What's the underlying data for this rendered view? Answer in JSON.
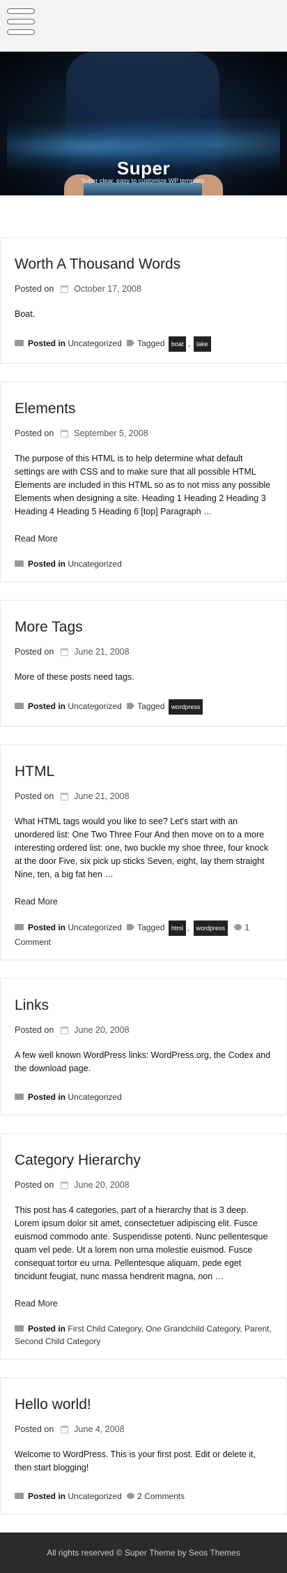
{
  "header": {
    "site_title": "Super",
    "tagline": "Super clear, easy to customize WP template."
  },
  "posts": [
    {
      "title": "Worth A Thousand Words",
      "posted_on": "Posted on",
      "date": "October 17, 2008",
      "excerpt": "Boat.",
      "posted_in_label": "Posted in",
      "categories": "Uncategorized",
      "tagged_label": "Tagged",
      "tags": [
        "boat",
        "lake"
      ]
    },
    {
      "title": "Elements",
      "posted_on": "Posted on",
      "date": "September 5, 2008",
      "excerpt": "The purpose of this HTML is to help determine what default settings are with CSS and to make sure that all possible HTML Elements are included in this HTML so as to not miss any possible Elements when designing a site. Heading 1 Heading 2 Heading 3 Heading 4 Heading 5 Heading 6 [top] Paragraph …",
      "read_more": "Read More",
      "posted_in_label": "Posted in",
      "categories": "Uncategorized"
    },
    {
      "title": "More Tags",
      "posted_on": "Posted on",
      "date": "June 21, 2008",
      "excerpt": "More of these posts need tags.",
      "posted_in_label": "Posted in",
      "categories": "Uncategorized",
      "tagged_label": "Tagged",
      "tags": [
        "wordpress"
      ]
    },
    {
      "title": "HTML",
      "posted_on": "Posted on",
      "date": "June 21, 2008",
      "excerpt": "What HTML tags would you like to see? Let's start with an unordered list: One Two Three Four And then move on to a more interesting ordered list: one, two buckle my shoe three, four knock at the door Five, six pick up sticks Seven, eight, lay them straight Nine, ten, a big fat hen …",
      "read_more": "Read More",
      "posted_in_label": "Posted in",
      "categories": "Uncategorized",
      "tagged_label": "Tagged",
      "tags": [
        "html",
        "wordpress"
      ],
      "comments": "1 Comment"
    },
    {
      "title": "Links",
      "posted_on": "Posted on",
      "date": "June 20, 2008",
      "excerpt": "A few well known WordPress links: WordPress.org, the Codex and the download page.",
      "posted_in_label": "Posted in",
      "categories": "Uncategorized"
    },
    {
      "title": "Category Hierarchy",
      "posted_on": "Posted on",
      "date": "June 20, 2008",
      "excerpt": "This post has 4 categories, part of a hierarchy that is 3 deep. Lorem ipsum dolor sit amet, consectetuer adipiscing elit. Fusce euismod commodo ante. Suspendisse potenti. Nunc pellentesque quam vel pede. Ut a lorem non urna molestie euismod. Fusce consequat tortor eu urna. Pellentesque aliquam, pede eget tincidunt feugiat, nunc massa hendrerit magna, non …",
      "read_more": "Read More",
      "posted_in_label": "Posted in",
      "categories": "First Child Category, One Grandchild Category, Parent, Second Child Category"
    },
    {
      "title": "Hello world!",
      "posted_on": "Posted on",
      "date": "June 4, 2008",
      "excerpt": "Welcome to WordPress. This is your first post. Edit or delete it, then start blogging!",
      "posted_in_label": "Posted in",
      "categories": "Uncategorized",
      "comments": "2 Comments"
    }
  ],
  "footer": {
    "rights": "All rights reserved ©",
    "site_name": "Super",
    "theme_by": "Theme by Seos Themes"
  }
}
